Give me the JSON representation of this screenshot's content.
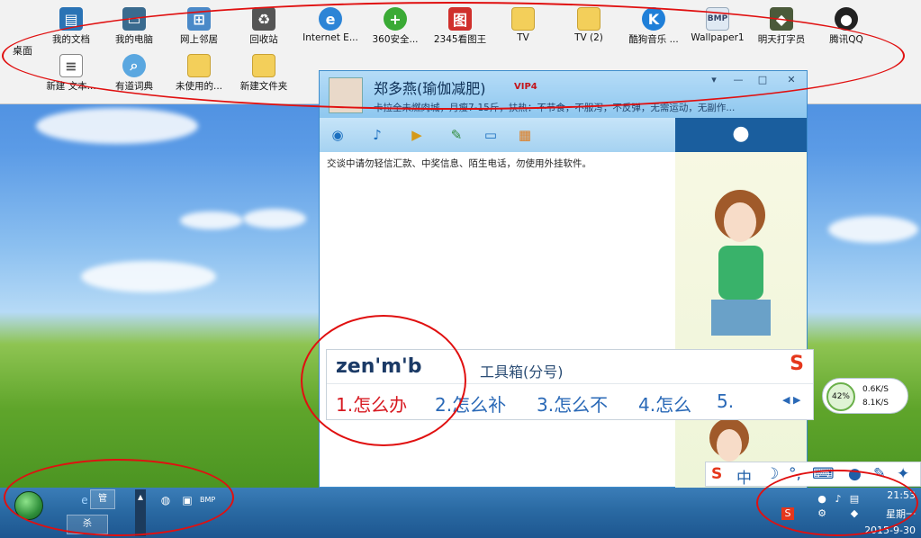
{
  "desktop": {
    "toolbar_label": "桌面",
    "icons": [
      {
        "label": "我的文档",
        "icon": "documents-icon"
      },
      {
        "label": "我的电脑",
        "icon": "computer-icon"
      },
      {
        "label": "网上邻居",
        "icon": "network-icon"
      },
      {
        "label": "回收站",
        "icon": "recycle-bin-icon"
      },
      {
        "label": "Internet E...",
        "icon": "ie-icon"
      },
      {
        "label": "360安全...",
        "icon": "360-icon"
      },
      {
        "label": "2345看图王",
        "icon": "image-viewer-icon"
      },
      {
        "label": "TV",
        "icon": "folder-icon"
      },
      {
        "label": "TV (2)",
        "icon": "folder-icon"
      },
      {
        "label": "酷狗音乐 ...",
        "icon": "kugou-icon"
      },
      {
        "label": "Wallpaper1",
        "icon": "bmp-icon"
      },
      {
        "label": "明天打字员",
        "icon": "typing-icon"
      },
      {
        "label": "腾讯QQ",
        "icon": "qq-icon"
      },
      {
        "label": "新建 文本...",
        "icon": "text-file-icon"
      },
      {
        "label": "有道词典",
        "icon": "youdao-icon"
      },
      {
        "label": "未使用的...",
        "icon": "folder-icon"
      },
      {
        "label": "新建文件夹",
        "icon": "folder-icon"
      }
    ]
  },
  "qq": {
    "contact_name": "郑多燕(瑜伽减肥)",
    "vip_badge": "VIP4",
    "signature": "卡拉全未燃肉城，月瘦7-15斤，扶热：不节食，不服泻，不反弹，无需运动，无副作...",
    "warning": "交谈中请勿轻信汇款、中奖信息、陌生电话，勿使用外挂软件。"
  },
  "ime": {
    "composition": "zen'm'b",
    "toolbox": "工具箱(分号)",
    "candidates": [
      "1.怎么办",
      "2.怎么补",
      "3.怎么不",
      "4.怎么",
      "5."
    ],
    "bar": {
      "logo": "S",
      "mode": "中"
    }
  },
  "network": {
    "percent": "42%",
    "up": "0.6K/S",
    "down": "8.1K/S"
  },
  "taskbar": {
    "tasks": [
      "管",
      "杀"
    ],
    "clock_time": "21:53",
    "clock_day": "星期一",
    "clock_date": "2015-9-30"
  },
  "colors": {
    "accent": "#1f5fa8",
    "highlight": "#d71921",
    "annotation": "#e01010"
  }
}
